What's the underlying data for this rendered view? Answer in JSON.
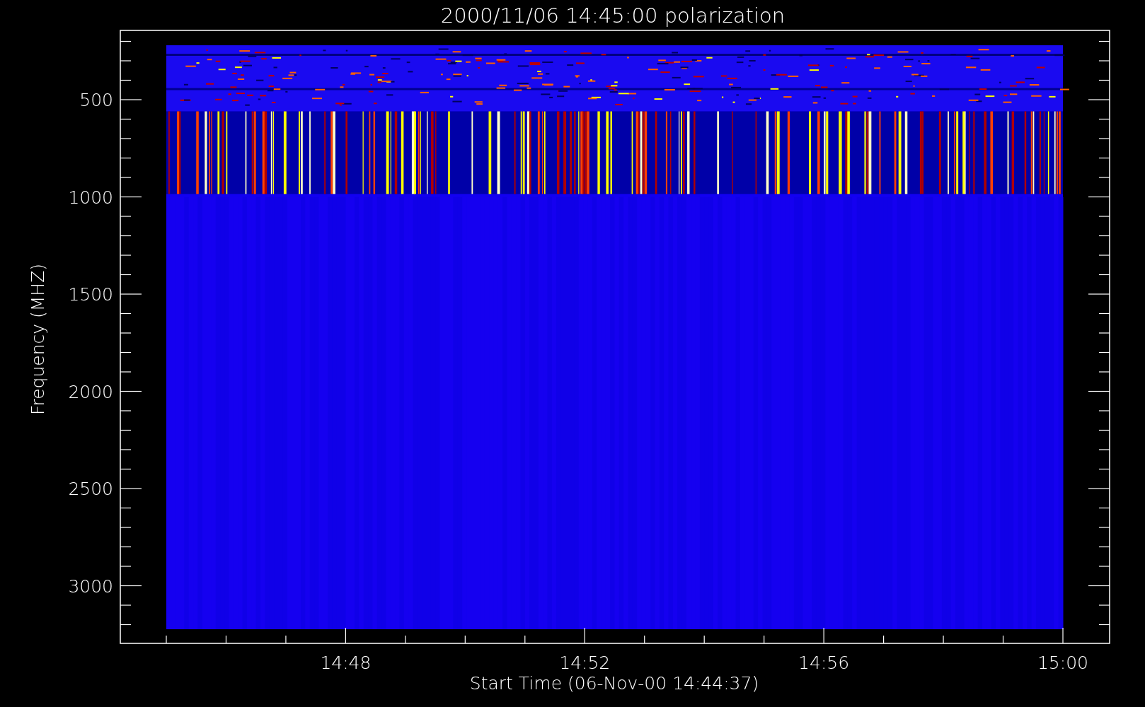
{
  "plot": {
    "title": "2000/11/06 14:45:00 polarization",
    "ylabel": "Frequency (MHZ)",
    "xlabel": "Start Time (06-Nov-00 14:44:37)",
    "yticks": [
      "500",
      "1000",
      "1500",
      "2000",
      "2500",
      "3000"
    ],
    "xticks": [
      "14:48",
      "14:52",
      "14:56",
      "15:00"
    ]
  }
}
